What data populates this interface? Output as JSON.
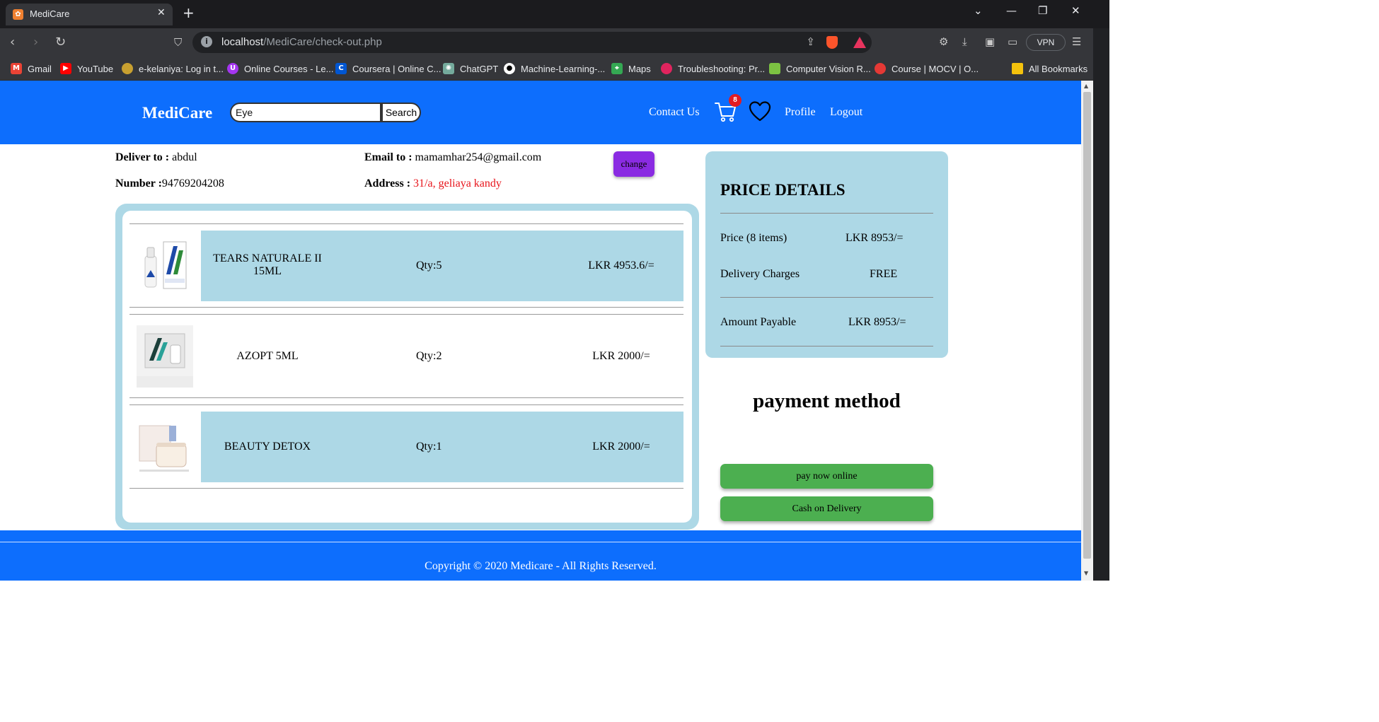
{
  "browser": {
    "tab_title": "MediCare",
    "url_host": "localhost",
    "url_path": "/MediCare/check-out.php",
    "vpn_label": "VPN",
    "bookmarks": [
      {
        "label": "Gmail",
        "icon": "gmail-icon",
        "color": "#ea4335"
      },
      {
        "label": "YouTube",
        "icon": "youtube-icon",
        "color": "#ff0000"
      },
      {
        "label": "e-kelaniya: Log in t...",
        "icon": "kelaniya-icon",
        "color": "#c8a030"
      },
      {
        "label": "Online Courses - Le...",
        "icon": "udemy-icon",
        "color": "#a435f0"
      },
      {
        "label": "Coursera | Online C...",
        "icon": "coursera-icon",
        "color": "#0056d2"
      },
      {
        "label": "ChatGPT",
        "icon": "chatgpt-icon",
        "color": "#74aa9c"
      },
      {
        "label": "Machine-Learning-...",
        "icon": "github-icon",
        "color": "#ffffff"
      },
      {
        "label": "Maps",
        "icon": "maps-icon",
        "color": "#34a853"
      },
      {
        "label": "Troubleshooting: Pr...",
        "icon": "troubleshoot-icon",
        "color": "#e0245e"
      },
      {
        "label": "Computer Vision R...",
        "icon": "cv-icon",
        "color": "#7cc242"
      },
      {
        "label": "Course | MOCV | O...",
        "icon": "mocv-icon",
        "color": "#e53935"
      },
      {
        "label": "All Bookmarks",
        "icon": "folder-icon",
        "color": "#f4c20d"
      }
    ]
  },
  "header": {
    "brand": "MediCare",
    "search_value": "Eye",
    "search_button": "Search",
    "contact": "Contact Us",
    "cart_count": "8",
    "profile": "Profile",
    "logout": "Logout"
  },
  "delivery": {
    "deliver_label": "Deliver to :",
    "deliver_value": " abdul",
    "number_label": "Number :",
    "number_value": "94769204208",
    "email_label": "Email to :",
    "email_value": " mamamhar254@gmail.com",
    "address_label": "Address :",
    "address_value": " 31/a, geliaya kandy",
    "change_button": "change"
  },
  "cart_items": [
    {
      "name": "TEARS NATURALE II 15ML",
      "qty": "Qty:5",
      "price": "LKR 4953.6/="
    },
    {
      "name": "AZOPT 5ML",
      "qty": "Qty:2",
      "price": "LKR 2000/="
    },
    {
      "name": "BEAUTY DETOX",
      "qty": "Qty:1",
      "price": "LKR 2000/="
    }
  ],
  "price_details": {
    "title": "PRICE DETAILS",
    "price_label": "Price (8 items)",
    "price_value": "LKR 8953/=",
    "delivery_label": "Delivery Charges",
    "delivery_value": "FREE",
    "payable_label": "Amount Payable",
    "payable_value": "LKR 8953/="
  },
  "payment": {
    "title": "payment method",
    "online_button": "pay now online",
    "cod_button": "Cash on Delivery"
  },
  "footer": {
    "copyright": "Copyright © 2020 Medicare - All Rights Reserved."
  },
  "colors": {
    "brand_blue": "#0d6efd",
    "panel_blue": "#add8e6",
    "change_purple": "#8a2be2",
    "pay_green": "#4caf50",
    "accent_red": "#e8141b"
  }
}
